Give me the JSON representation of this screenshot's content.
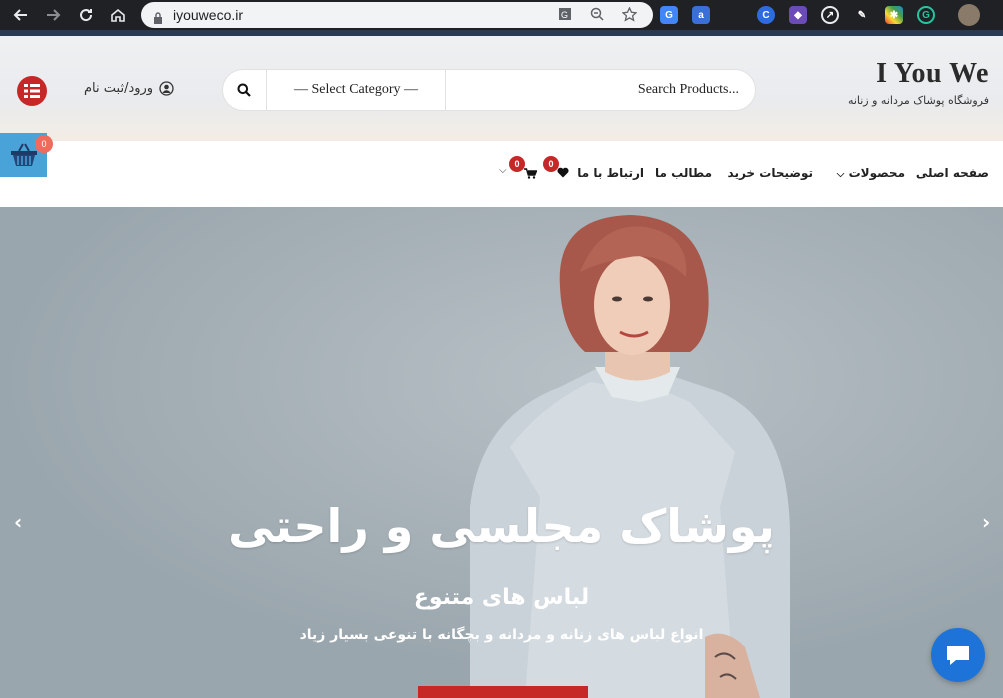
{
  "browser": {
    "url": "iyouweco.ir"
  },
  "header": {
    "brand_name": "I You We",
    "brand_tagline": "فروشگاه پوشاک مردانه و زنانه",
    "search_placeholder": "Search Products...",
    "category_select": "— Select Category —",
    "login_label": "ورود/ثبت نام"
  },
  "cart_float": {
    "count": "0"
  },
  "nav": {
    "items": [
      {
        "label": "صفحه اصلی"
      },
      {
        "label": "محصولات"
      },
      {
        "label": "توضیحات خرید"
      },
      {
        "label": "مطالب ما"
      },
      {
        "label": "ارتباط با ما"
      }
    ],
    "wishlist_count": "0",
    "cart_count": "0"
  },
  "hero": {
    "title": "پوشاک مجلسی و راحتی",
    "subtitle": "لباس های متنوع",
    "description": "انواع لباس های زنانه و مردانه و بچگانه با تنوعی بسیار زیاد"
  },
  "colors": {
    "accent": "#c62828",
    "cart_float": "#4aa3d8",
    "chat": "#1e73d8"
  }
}
